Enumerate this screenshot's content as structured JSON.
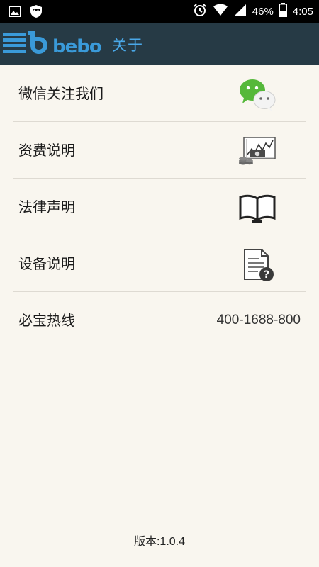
{
  "status_bar": {
    "battery": "46%",
    "time": "4:05",
    "icons": [
      "image-icon",
      "shield-mask-icon",
      "alarm-icon",
      "wifi-icon",
      "signal-icon",
      "battery-icon"
    ]
  },
  "header": {
    "brand": "bebo",
    "title": "关于"
  },
  "menu": {
    "items": [
      {
        "label": "微信关注我们",
        "icon": "wechat-icon"
      },
      {
        "label": "资费说明",
        "icon": "pricing-chart-icon"
      },
      {
        "label": "法律声明",
        "icon": "open-book-icon"
      },
      {
        "label": "设备说明",
        "icon": "document-question-icon"
      },
      {
        "label": "必宝热线",
        "value": "400-1688-800"
      }
    ]
  },
  "footer": {
    "version_label": "版本",
    "version_value": ":1.0.4"
  },
  "colors": {
    "status_bar": "#000000",
    "app_bar": "#263a45",
    "brand_blue": "#4aa8e8",
    "background": "#f9f6ef",
    "divider": "#dedad2"
  }
}
